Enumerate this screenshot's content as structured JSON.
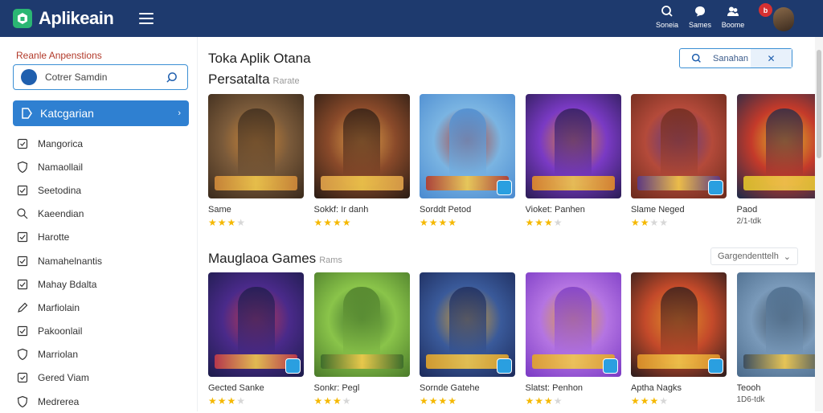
{
  "app": {
    "name": "Aplikeain",
    "brand_color": "#1e3a6e",
    "accent": "#2f80d1"
  },
  "header": {
    "actions": [
      {
        "label": "Soneia",
        "icon": "search-icon"
      },
      {
        "label": "Sames",
        "icon": "chat-icon"
      },
      {
        "label": "Boome",
        "icon": "users-icon"
      }
    ],
    "notification_count": "b",
    "avatar": "user-avatar"
  },
  "sidebar": {
    "title": "Reanle Anpenstions",
    "search_text": "Cotrer Samdin",
    "active_item": "Katcgarian",
    "items": [
      {
        "label": "Mangorica",
        "icon": "square-icon"
      },
      {
        "label": "Namaollail",
        "icon": "shield-icon"
      },
      {
        "label": "Seetodina",
        "icon": "check-square-icon"
      },
      {
        "label": "Kaeendian",
        "icon": "search-icon"
      },
      {
        "label": "Harotte",
        "icon": "check-square-icon"
      },
      {
        "label": "Namahelnantis",
        "icon": "check-square-icon"
      },
      {
        "label": "Mahay Bdalta",
        "icon": "check-square-icon"
      },
      {
        "label": "Marfiolain",
        "icon": "pen-icon"
      },
      {
        "label": "Pakoonlail",
        "icon": "check-square-icon"
      },
      {
        "label": "Marriolan",
        "icon": "shield-icon"
      },
      {
        "label": "Gered Viam",
        "icon": "square-icon"
      },
      {
        "label": "Medrerea",
        "icon": "shield-icon"
      }
    ]
  },
  "main": {
    "title": "Toka Aplik Otana",
    "search_text": "Sanahan",
    "section1": {
      "title": "Persatalta",
      "subtitle": "Rarate"
    },
    "section2": {
      "title": "Mauglaoa Games",
      "subtitle": "Rams",
      "sort_label": "Gargendenttelh"
    },
    "row1": [
      {
        "name": "Same",
        "stars": 3,
        "colors": [
          "#3a2a1c",
          "#7a5a3a",
          "#d28a3a"
        ]
      },
      {
        "name": "Sokkf: Ir danh",
        "stars": 4,
        "colors": [
          "#2a1c14",
          "#8a4a2a",
          "#e2a24a"
        ]
      },
      {
        "name": "Sorddt Petod",
        "stars": 4,
        "colors": [
          "#4a8ad0",
          "#7ab4e2",
          "#b43a2a"
        ]
      },
      {
        "name": "Vioket: Panhen",
        "stars": 3,
        "colors": [
          "#2a1c54",
          "#7a3ac4",
          "#e28a2a"
        ]
      },
      {
        "name": "Slame Neged",
        "stars": 2,
        "colors": [
          "#6a2a1c",
          "#b44a3a",
          "#5a3a8a"
        ]
      },
      {
        "name": "Paod",
        "rating_text": "2/1-tdk",
        "colors": [
          "#1c2a4a",
          "#c43a2a",
          "#e2c42a"
        ]
      }
    ],
    "row2": [
      {
        "name": "Gected Sanke",
        "stars": 3,
        "colors": [
          "#1c1c4a",
          "#4a2a8a",
          "#c43a4a"
        ]
      },
      {
        "name": "Sonkr: Pegl",
        "stars": 3,
        "colors": [
          "#4a7a2a",
          "#8ac44a",
          "#3a6a2a"
        ]
      },
      {
        "name": "Sornde Gatehe",
        "stars": 4,
        "colors": [
          "#1c2a5a",
          "#3a5a9a",
          "#e2a42a"
        ]
      },
      {
        "name": "Slatst: Penhon",
        "stars": 3,
        "colors": [
          "#7a3ac4",
          "#b474e2",
          "#e2a42a"
        ]
      },
      {
        "name": "Aptha Nagks",
        "stars": 3,
        "colors": [
          "#2a1c1c",
          "#c44a2a",
          "#e2942a"
        ]
      },
      {
        "name": "Teooh",
        "rating_text": "1D6-tdk",
        "colors": [
          "#4a6a8a",
          "#7a9aba",
          "#3a4a5a"
        ]
      }
    ]
  }
}
